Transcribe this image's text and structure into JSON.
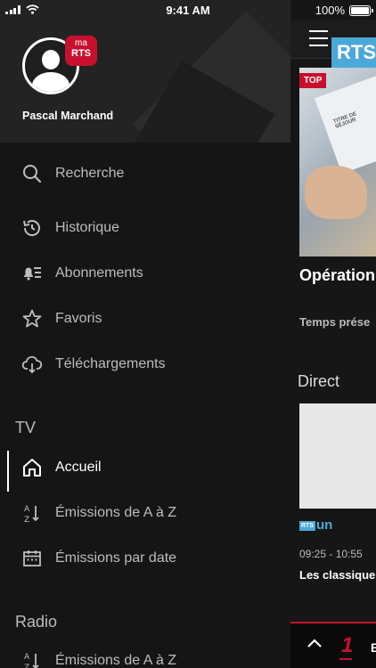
{
  "status_bar": {
    "time": "9:41 AM",
    "battery": "100%",
    "battery_level": 1.0
  },
  "profile": {
    "badge_ma": "ma",
    "badge_rts": "RTS",
    "name": "Pascal Marchand"
  },
  "menu": {
    "general": [
      {
        "label": "Recherche",
        "icon": "search-icon"
      },
      {
        "label": "Historique",
        "icon": "history-icon"
      },
      {
        "label": "Abonnements",
        "icon": "subscriptions-icon"
      },
      {
        "label": "Favoris",
        "icon": "star-icon"
      },
      {
        "label": "Téléchargements",
        "icon": "download-icon"
      }
    ],
    "tv_title": "TV",
    "tv": [
      {
        "label": "Accueil",
        "icon": "home-icon",
        "active": true
      },
      {
        "label": "Émissions de A à Z",
        "icon": "sort-az-icon"
      },
      {
        "label": "Émissions par date",
        "icon": "calendar-icon"
      }
    ],
    "radio_title": "Radio",
    "radio": [
      {
        "label": "Émissions de A à Z",
        "icon": "sort-az-icon"
      }
    ]
  },
  "main": {
    "top_badge": "TOP",
    "hero_card_text": "TITRE DE SÉJOUR",
    "hero_title": "Opération travail au",
    "hero_subtitle": "Temps prése",
    "direct_title": "Direct",
    "live_logo": "RTS",
    "channel_badge_rts": "RTS",
    "channel_badge_un": "un",
    "live_time": "09:25 - 10:55",
    "live_title": "Les classique",
    "player_channel": "1",
    "player_letter": "E"
  },
  "colors": {
    "accent": "#c8102e",
    "drawer_bg": "#151515",
    "drawer_header_bg": "#232323",
    "rts_blue": "#4ba9d9"
  }
}
